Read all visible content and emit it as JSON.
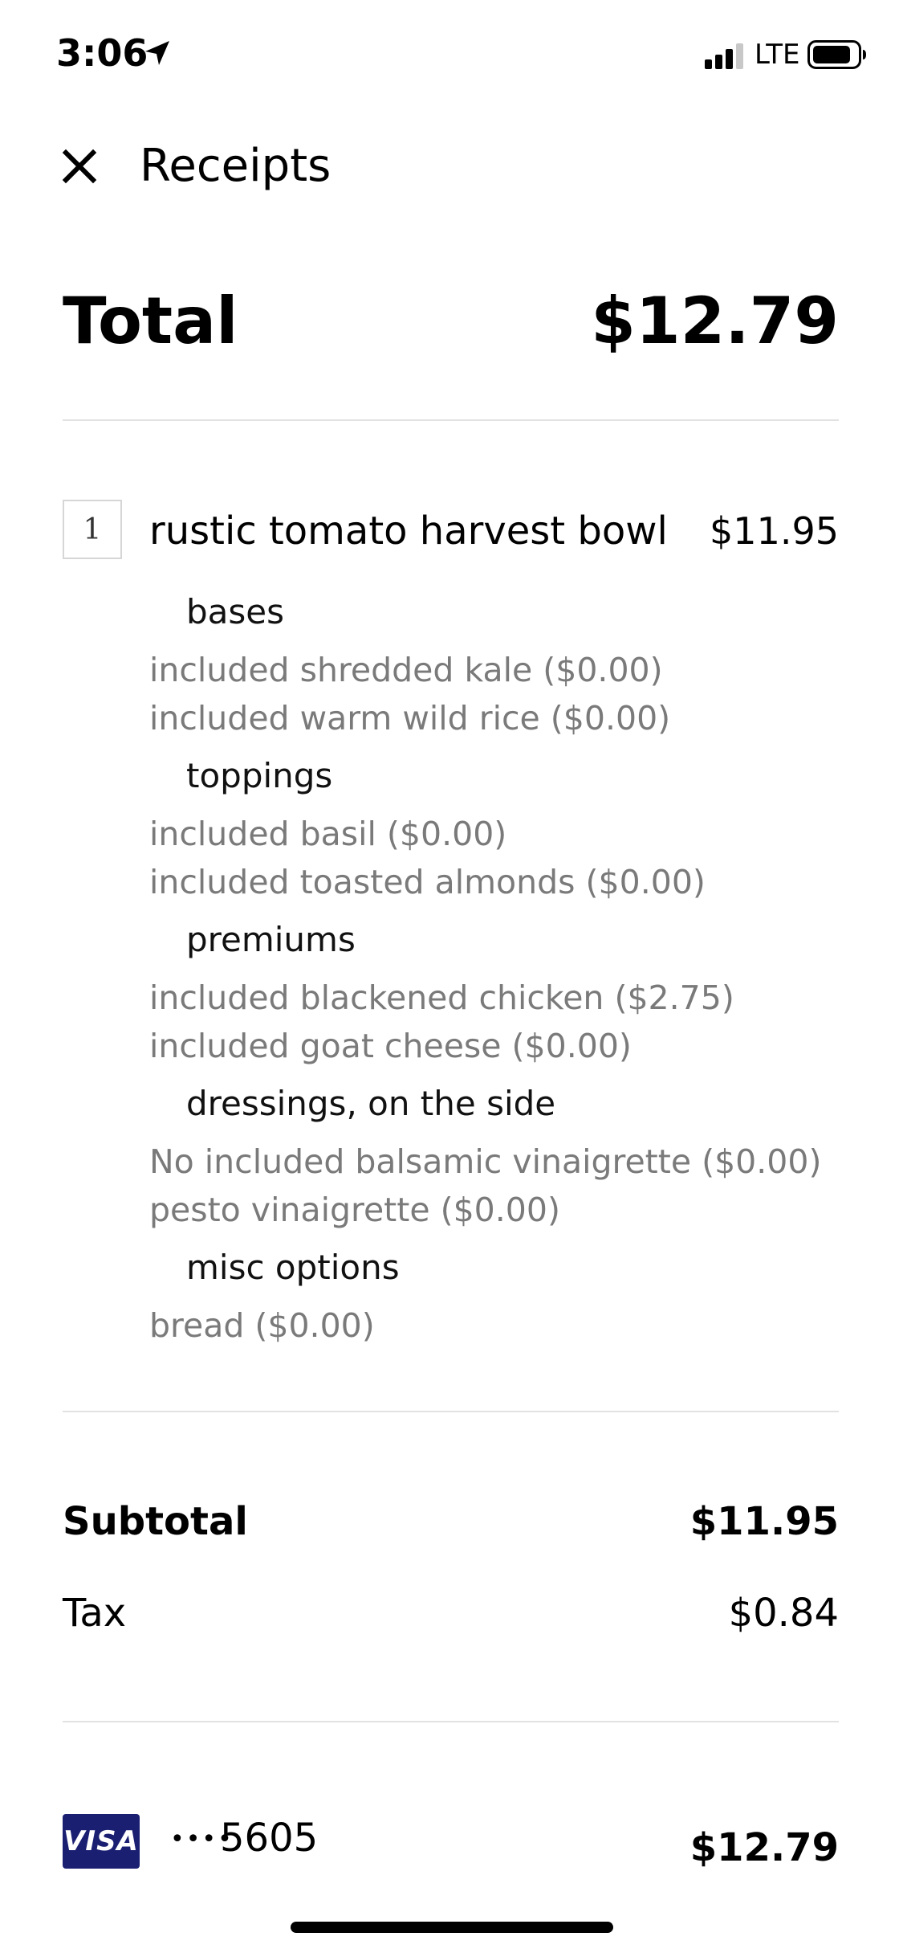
{
  "status_bar": {
    "time": "3:06",
    "network": "LTE",
    "icons": [
      "location-arrow-icon",
      "cellular-signal-icon",
      "battery-icon"
    ]
  },
  "header": {
    "title": "Receipts",
    "close_icon": "close-icon"
  },
  "total": {
    "label": "Total",
    "value": "$12.79"
  },
  "item": {
    "quantity": "1",
    "name": "rustic tomato harvest bowl",
    "price": "$11.95",
    "option_groups": [
      {
        "heading": "bases",
        "lines": [
          "included shredded kale ($0.00)",
          "included warm wild rice ($0.00)"
        ]
      },
      {
        "heading": "toppings",
        "lines": [
          "included basil ($0.00)",
          "included toasted almonds ($0.00)"
        ]
      },
      {
        "heading": "premiums",
        "lines": [
          "included blackened chicken ($2.75)",
          "included goat cheese ($0.00)"
        ]
      },
      {
        "heading": "dressings, on the side",
        "lines": [
          "No included balsamic vinaigrette ($0.00)",
          "pesto vinaigrette ($0.00)"
        ]
      },
      {
        "heading": "misc options",
        "lines": [
          "bread ($0.00)"
        ]
      }
    ]
  },
  "summary": {
    "subtotal_label": "Subtotal",
    "subtotal_value": "$11.95",
    "tax_label": "Tax",
    "tax_value": "$0.84"
  },
  "payment": {
    "card_brand": "VISA",
    "card_mask": "••••",
    "card_last4": "5605",
    "amount": "$12.79"
  },
  "colors": {
    "visa_blue": "#1a1f71",
    "option_gray": "#7a7a7a",
    "divider": "#e2e2e2"
  }
}
